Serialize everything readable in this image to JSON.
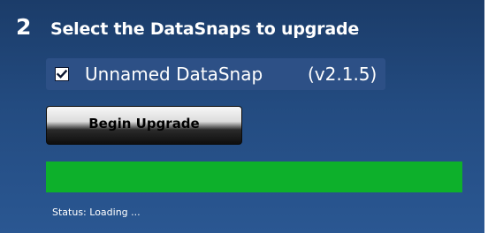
{
  "step": {
    "number": "2",
    "title": "Select the DataSnaps to upgrade"
  },
  "datasnaps": [
    {
      "name": "Unnamed DataSnap",
      "version": "(v2.1.5)",
      "checked": true
    }
  ],
  "actions": {
    "begin_label": "Begin Upgrade"
  },
  "progress": {
    "percent": 100,
    "color": "#0db02b"
  },
  "status": {
    "text": "Status: Loading ..."
  },
  "colors": {
    "background": "#234b80",
    "progress_fill": "#0db02b",
    "text": "#ffffff"
  }
}
